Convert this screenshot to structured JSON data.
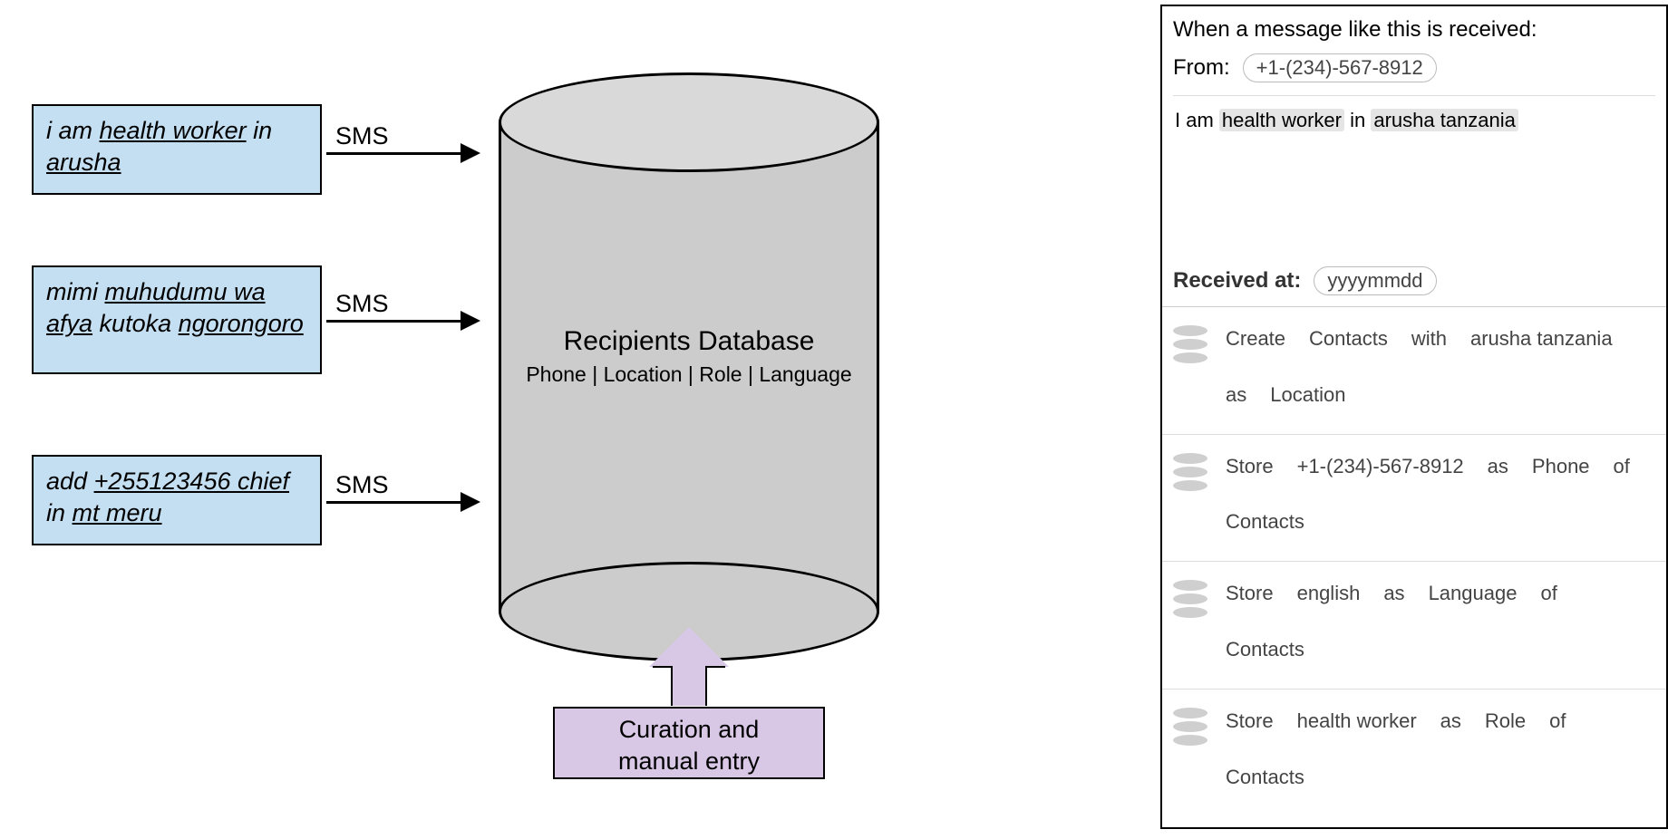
{
  "sms": [
    {
      "segments": [
        {
          "t": "i am ",
          "u": false
        },
        {
          "t": "health worker",
          "u": true
        },
        {
          "t": " in ",
          "u": false
        },
        {
          "t": "arusha",
          "u": true
        }
      ]
    },
    {
      "segments": [
        {
          "t": "mimi ",
          "u": false
        },
        {
          "t": "muhudumu wa afya",
          "u": true
        },
        {
          "t": " kutoka ",
          "u": false
        },
        {
          "t": "ngorongoro",
          "u": true
        }
      ]
    },
    {
      "segments": [
        {
          "t": "add ",
          "u": false
        },
        {
          "t": "+255123456 chief",
          "u": true
        },
        {
          "t": " in ",
          "u": false
        },
        {
          "t": "mt meru",
          "u": true
        }
      ]
    }
  ],
  "arrow_label": "SMS",
  "db": {
    "title": "Recipients Database",
    "subtitle": "Phone | Location | Role | Language"
  },
  "curation": {
    "line1": "Curation and",
    "line2": "manual entry"
  },
  "panel": {
    "intro": "When a message like this is received:",
    "from_label": "From:",
    "from_value": "+1-(234)-567-8912",
    "body": {
      "pre": "I am ",
      "hl1": "health worker",
      "mid": " in ",
      "hl2": "arusha tanzania"
    },
    "received_label": "Received at:",
    "received_value": "yyyymmdd",
    "rules": [
      [
        "Create",
        "Contacts",
        "with",
        "arusha tanzania",
        "as",
        "Location"
      ],
      [
        "Store",
        "+1-(234)-567-8912",
        "as",
        "Phone",
        "of",
        "Contacts"
      ],
      [
        "Store",
        "english",
        "as",
        "Language",
        "of",
        "Contacts"
      ],
      [
        "Store",
        "health worker",
        "as",
        "Role",
        "of",
        "Contacts"
      ]
    ]
  }
}
